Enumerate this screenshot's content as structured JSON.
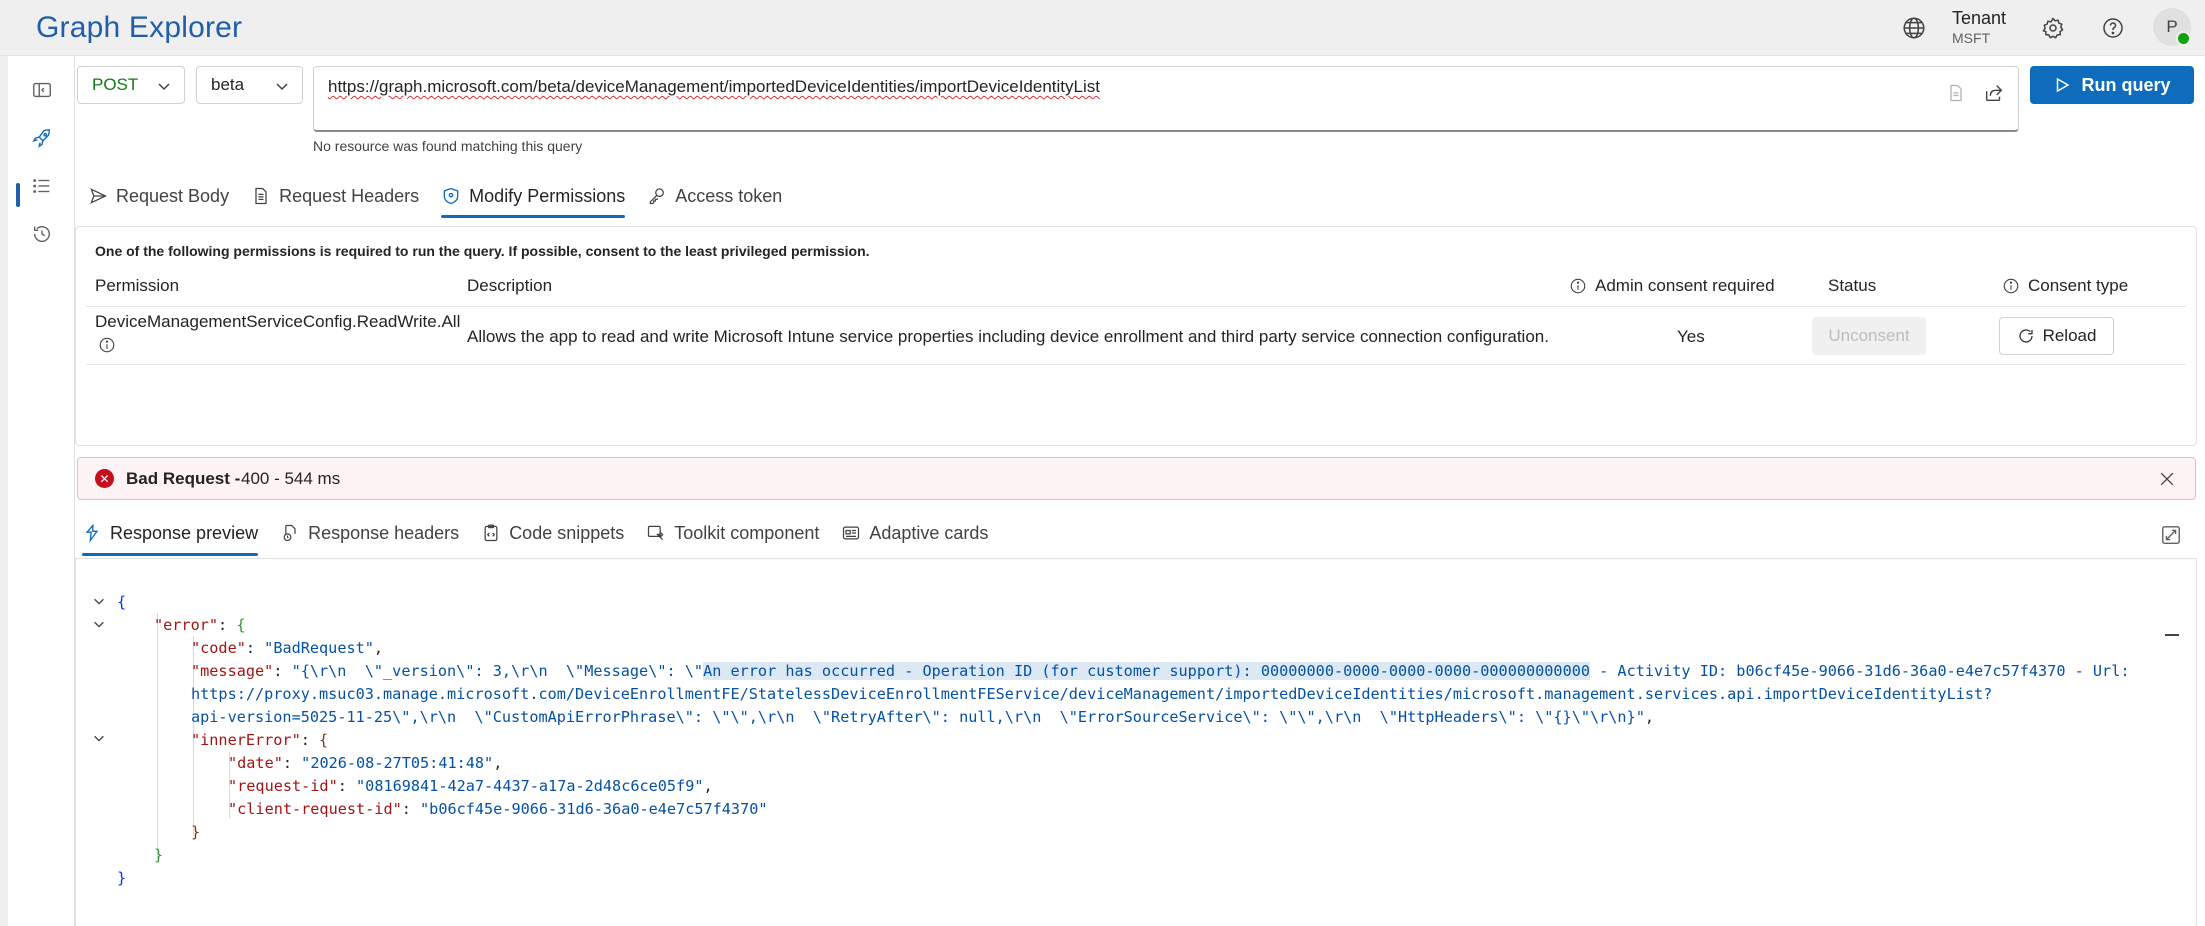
{
  "app": {
    "title": "Graph Explorer"
  },
  "header": {
    "tenant_label": "Tenant",
    "tenant_name": "MSFT",
    "avatar_initial": "P"
  },
  "query": {
    "method": "POST",
    "version": "beta",
    "url": "https://graph.microsoft.com/beta/deviceManagement/importedDeviceIdentities/importDeviceIdentityList",
    "hint": "No resource was found matching this query",
    "run_label": "Run query"
  },
  "request_tabs": [
    {
      "label": "Request Body",
      "icon": "send-icon"
    },
    {
      "label": "Request Headers",
      "icon": "document-icon"
    },
    {
      "label": "Modify Permissions",
      "icon": "shield-icon",
      "active": true
    },
    {
      "label": "Access token",
      "icon": "key-icon"
    }
  ],
  "permissions": {
    "note": "One of the following permissions is required to run the query. If possible, consent to the least privileged permission.",
    "columns": {
      "permission": "Permission",
      "description": "Description",
      "admin_consent": "Admin consent required",
      "status": "Status",
      "consent_type": "Consent type"
    },
    "rows": [
      {
        "permission": "DeviceManagementServiceConfig.ReadWrite.All",
        "description": "Allows the app to read and write Microsoft Intune service properties including device enrollment and third party service connection configuration.",
        "admin_consent": "Yes",
        "status_button": "Unconsent",
        "consent_button": "Reload"
      }
    ]
  },
  "status_bar": {
    "title": "Bad Request -",
    "detail": "400 - 544 ms",
    "color": "#c50f1f"
  },
  "response_tabs": [
    {
      "label": "Response preview",
      "icon": "preview-icon",
      "active": true
    },
    {
      "label": "Response headers",
      "icon": "headers-icon"
    },
    {
      "label": "Code snippets",
      "icon": "clipboard-code-icon"
    },
    {
      "label": "Toolkit component",
      "icon": "toolkit-icon"
    },
    {
      "label": "Adaptive cards",
      "icon": "card-icon"
    }
  ],
  "response": {
    "code_value": "\"BadRequest\"",
    "message_line1_a": "\"{\\r\\n  \\\"_version\\\": 3,\\r\\n  \\\"Message\\\": \\\"",
    "message_line1_hl": "An error has occurred - Operation ID (for customer support): 00000000-0000-0000-0000-000000000000",
    "message_line1_b": " - Activity ID: b06cf45e-9066-31d6-36a0-e4e7c57f4370 - Url:",
    "message_line2": "https://proxy.msuc03.manage.microsoft.com/DeviceEnrollmentFE/StatelessDeviceEnrollmentFEService/deviceManagement/importedDeviceIdentities/microsoft.management.services.api.importDeviceIdentityList?",
    "message_line3": "api-version=5025-11-25\\\",\\r\\n  \\\"CustomApiErrorPhrase\\\": \\\"\\\",\\r\\n  \\\"RetryAfter\\\": null,\\r\\n  \\\"ErrorSourceService\\\": \\\"\\\",\\r\\n  \\\"HttpHeaders\\\": \\\"{}\\\"\\r\\n}\"",
    "date_value": "\"2026-08-27T05:41:48\"",
    "request_id_value": "\"08169841-42a7-4437-a17a-2d48c6ce05f9\"",
    "client_request_id_value": "\"b06cf45e-9066-31d6-36a0-e4e7c57f4370\""
  },
  "colors": {
    "brand": "#1f5ea8",
    "accent": "#0f6cbd",
    "error": "#c50f1f"
  }
}
